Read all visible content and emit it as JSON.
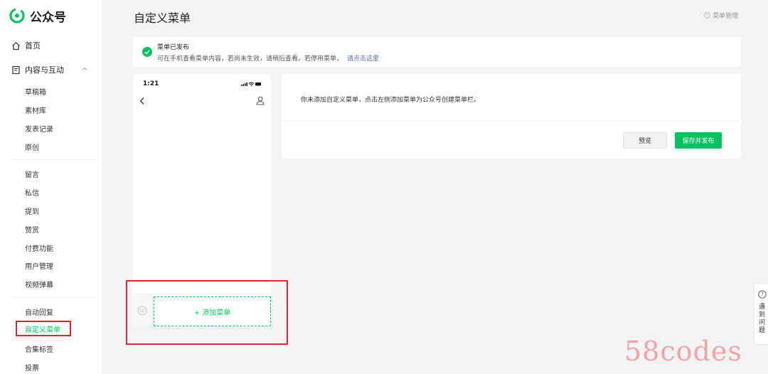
{
  "app": {
    "name": "公众号",
    "brand_color": "#07c160"
  },
  "sidebar": {
    "home": "首页",
    "content_group": "内容与互动",
    "content_items": [
      "草稿箱",
      "素材库",
      "发表记录",
      "原创"
    ],
    "interaction_items": [
      "留言",
      "私信",
      "提到",
      "赞赏",
      "付费功能",
      "用户管理",
      "视频弹幕"
    ],
    "feature_items": [
      "自动回复",
      "自定义菜单",
      "合集标签",
      "投票"
    ],
    "active_item": "自定义菜单"
  },
  "header": {
    "title": "自定义菜单",
    "help": "菜单管理"
  },
  "notice": {
    "title": "菜单已发布",
    "desc": "可在手机查看菜单内容，若尚未生效，请稍后查看。若停用菜单，",
    "link": "请点击这里"
  },
  "phone": {
    "time": "1:21",
    "add_menu": "+ 添加菜单"
  },
  "panel": {
    "message": "你未添加自定义菜单，点击左侧添加菜单为公众号创建菜单栏。",
    "preview_button": "预览",
    "save_button": "保存并发布"
  },
  "float_help": {
    "text": "遇到问题"
  },
  "watermark": "58codes"
}
